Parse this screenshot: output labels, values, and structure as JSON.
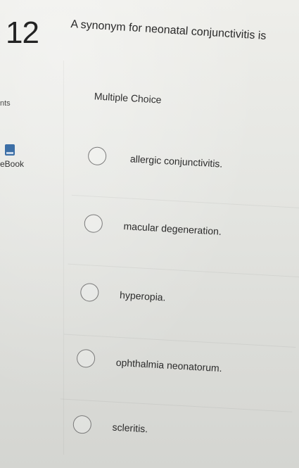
{
  "question": {
    "number": "12",
    "text": "A synonym for neonatal conjunctivitis is"
  },
  "sidebar": {
    "points_label": "nts",
    "ebook_label": "eBook"
  },
  "answer_area": {
    "type_label": "Multiple Choice",
    "options": [
      {
        "label": "allergic conjunctivitis.",
        "selected": false
      },
      {
        "label": "macular degeneration.",
        "selected": false
      },
      {
        "label": "hyperopia.",
        "selected": false
      },
      {
        "label": "ophthalmia neonatorum.",
        "selected": false
      },
      {
        "label": "scleritis.",
        "selected": false
      }
    ]
  },
  "colors": {
    "background": "#e6e7e3",
    "text": "#2b2b2b",
    "radio_border": "#7a7a7a",
    "ebook_icon": "#3c6fa6"
  }
}
